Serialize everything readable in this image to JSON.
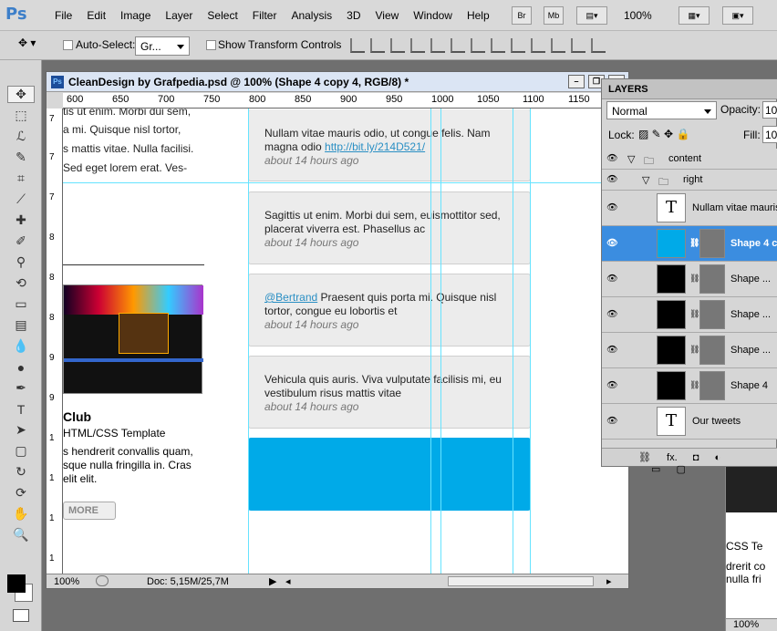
{
  "app": {
    "logo": "Ps",
    "menus": [
      "File",
      "Edit",
      "Image",
      "Layer",
      "Select",
      "Filter",
      "Analysis",
      "3D",
      "View",
      "Window",
      "Help"
    ],
    "zoom": "100%"
  },
  "options": {
    "auto_select": "Auto-Select:",
    "layer_select": "Gr...",
    "show_transform": "Show Transform Controls"
  },
  "document": {
    "title": "CleanDesign by Grafpedia.psd @ 100% (Shape 4 copy 4, RGB/8) *",
    "zoom": "100%",
    "doc_size": "Doc: 5,15M/25,7M",
    "ruler_h": [
      "600",
      "650",
      "700",
      "750",
      "800",
      "850",
      "900",
      "950",
      "1000",
      "1050",
      "1100",
      "1150"
    ],
    "ruler_v": [
      "7",
      "7",
      "7",
      "8",
      "8",
      "8",
      "9",
      "9",
      "1",
      "1",
      "1",
      "1"
    ],
    "left_text": [
      "tis ut enim. Morbi dui sem,",
      "a mi. Quisque nisl tortor,",
      "s mattis vitae. Nulla facilisi.",
      "Sed eget lorem erat. Ves-"
    ],
    "club_title": "Club",
    "club_subtitle": "HTML/CSS Template",
    "club_text": [
      "s hendrerit convallis quam,",
      "sque nulla fringilla in. Cras",
      "elit elit."
    ],
    "more": "MORE",
    "tweets": [
      {
        "text": "Nullam vitae mauris odio, ut congue felis. Nam magna odio ",
        "link": "http://bit.ly/214D521/",
        "time": "about 14 hours ago"
      },
      {
        "text": "Sagittis ut enim. Morbi dui sem, euismottitor sed, placerat viverra est. Phasellus ac",
        "time": "about 14 hours ago"
      },
      {
        "mention": "@Bertrand",
        "text": " Praesent quis porta mi. Quisque nisl tortor, congue eu lobortis et",
        "time": "about 14 hours ago"
      },
      {
        "text": "Vehicula quis auris. Viva vulputate facilisis mi, eu vestibulum risus mattis vitae",
        "time": "about 14 hours ago"
      }
    ]
  },
  "layers": {
    "title": "LAYERS",
    "blend": "Normal",
    "opacity_label": "Opacity:",
    "opacity": "10",
    "lock_label": "Lock:",
    "fill_label": "Fill:",
    "fill": "10",
    "rows": [
      "content",
      "right",
      "Nullam vitae mauris",
      "Shape 4 c",
      "Shape ...",
      "Shape ...",
      "Shape ...",
      "Shape 4",
      "Our tweets"
    ]
  },
  "right_doc": {
    "lines": [
      "CSS Te",
      "drerit co",
      "nulla fri"
    ],
    "zoom": "100%"
  }
}
